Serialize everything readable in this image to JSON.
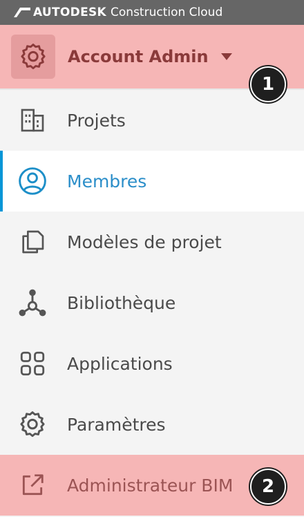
{
  "brand": {
    "name": "AUTODESK",
    "product": "Construction Cloud"
  },
  "account": {
    "label": "Account Admin",
    "badge": "1"
  },
  "nav": {
    "items": [
      {
        "label": "Projets",
        "icon": "buildings-icon"
      },
      {
        "label": "Membres",
        "icon": "user-circle-icon",
        "active": true
      },
      {
        "label": "Modèles de projet",
        "icon": "copy-icon"
      },
      {
        "label": "Bibliothèque",
        "icon": "library-node-icon"
      },
      {
        "label": "Applications",
        "icon": "grid-apps-icon"
      },
      {
        "label": "Paramètres",
        "icon": "gear-icon"
      },
      {
        "label": "Administrateur BIM",
        "icon": "external-link-icon",
        "badge": "2"
      }
    ]
  },
  "colors": {
    "accent": "#0696d7",
    "highlight": "#f6b6b6",
    "topbar": "#666666"
  }
}
